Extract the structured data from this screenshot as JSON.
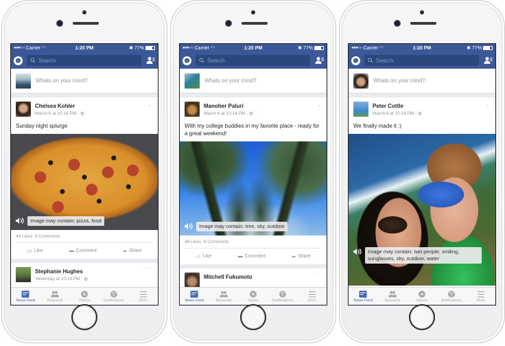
{
  "phones": [
    {
      "status": {
        "carrier": "Carrier",
        "time": "1:20 PM",
        "battery": "77%",
        "battery_level": 0.77
      },
      "search_placeholder": "Search",
      "composer_placeholder": "Whats on your mind?",
      "post": {
        "author": "Chelsea Kohler",
        "timestamp": "March 6 at 10:14 PM",
        "text": "Sunday night splurge",
        "alt_text": "Image may contain: pizza, food",
        "likes": "48 Likes",
        "comments": "6 Comments"
      },
      "actions": {
        "like": "Like",
        "comment": "Comment",
        "share": "Share"
      },
      "next_post": {
        "author": "Stephanie Hughes",
        "timestamp": "Yesterday at 10:14 PM"
      }
    },
    {
      "status": {
        "carrier": "Carrier",
        "time": "1:20 PM",
        "battery": "77%",
        "battery_level": 0.77
      },
      "search_placeholder": "Search",
      "composer_placeholder": "Whats on your mind?",
      "post": {
        "author": "Manoher Paluri",
        "timestamp": "March 6 at 10:14 PM",
        "text": "With my college buddies in my favorite place - ready for a great weekend!",
        "alt_text": "Image may contain: tree, sky, outdoor",
        "likes": "48 Likes",
        "comments": "6 Comments"
      },
      "actions": {
        "like": "Like",
        "comment": "Comment",
        "share": "Share"
      },
      "next_post": {
        "author": "Mitchell Fukumoto"
      }
    },
    {
      "status": {
        "carrier": "Carrier",
        "time": "1:20 PM",
        "battery": "77%",
        "battery_level": 0.77
      },
      "search_placeholder": "Search",
      "composer_placeholder": "Whats on your mind?",
      "post": {
        "author": "Peter Cottle",
        "timestamp": "March 6 at 10:14 PM",
        "text": "We finally made it :)",
        "alt_text": "Image may contain: two people, smiling, sunglasses, sky, outdoor, water"
      }
    }
  ],
  "tabbar": {
    "items": [
      {
        "label": "News Feed",
        "icon": "news-feed-icon",
        "active": true
      },
      {
        "label": "Requests",
        "icon": "requests-icon",
        "active": false
      },
      {
        "label": "Videos",
        "icon": "videos-icon",
        "active": false
      },
      {
        "label": "Notifications",
        "icon": "notifications-icon",
        "active": false
      },
      {
        "label": "More",
        "icon": "more-icon",
        "active": false
      }
    ]
  },
  "colors": {
    "brand": "#3b5998",
    "search_bg": "#29487d",
    "active_tab": "#4267b2",
    "muted": "#90949c"
  }
}
